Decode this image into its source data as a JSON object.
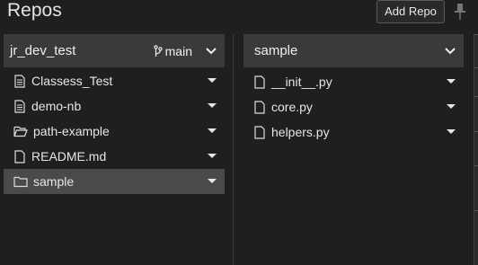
{
  "header": {
    "title": "Repos",
    "add_repo_label": "Add Repo"
  },
  "left_panel": {
    "repo_name": "jr_dev_test",
    "branch": "main",
    "items": [
      {
        "name": "Classess_Test",
        "type": "notebook"
      },
      {
        "name": "demo-nb",
        "type": "notebook"
      },
      {
        "name": "path-example",
        "type": "folder-open"
      },
      {
        "name": "README.md",
        "type": "file"
      },
      {
        "name": "sample",
        "type": "folder",
        "selected": true
      }
    ]
  },
  "right_panel": {
    "folder_name": "sample",
    "items": [
      {
        "name": "__init__.py",
        "type": "file"
      },
      {
        "name": "core.py",
        "type": "file"
      },
      {
        "name": "helpers.py",
        "type": "file"
      }
    ]
  },
  "colors": {
    "background": "#1f1f1f",
    "header": "#3a3a3a",
    "selected": "#4a4a4a",
    "text": "#e6e6e6"
  },
  "icons": [
    "pin-icon",
    "branch-icon",
    "chevron-down-icon",
    "notebook-icon",
    "folder-open-icon",
    "folder-icon",
    "file-icon",
    "caret-down-icon"
  ]
}
